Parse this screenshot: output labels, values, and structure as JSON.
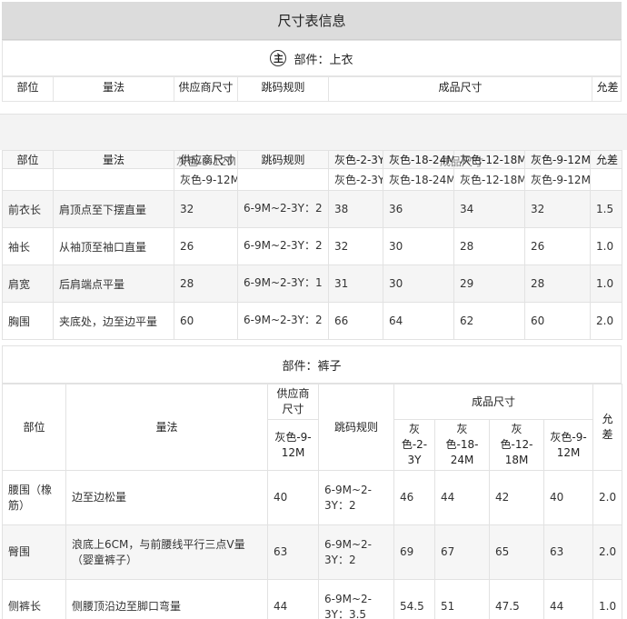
{
  "page_title": "尺寸表信息",
  "top_section": {
    "badge": "主",
    "part_label": "部件：上衣",
    "header": {
      "position": "部位",
      "method": "量法",
      "supplier_size": "供应商尺寸",
      "grading_rule": "跳码规则",
      "finished_size": "成品尺寸",
      "tolerance": "允差"
    }
  },
  "top_table": {
    "header_row1": [
      "部位",
      "量法",
      "供应商尺寸",
      "跳码规则",
      "灰色-2-3Y",
      "灰色-18-24M",
      "灰色-12-18M",
      "灰色-9-12M",
      "允差"
    ],
    "overlap_text": {
      "supplier_under": "灰色-9-12M",
      "finished_under": "成品尺寸"
    },
    "header_row2": [
      "",
      "",
      "灰色-9-12M",
      "",
      "灰色-2-3Y",
      "灰色-18-24M",
      "灰色-12-18M",
      "灰色-9-12M",
      ""
    ],
    "rows": [
      [
        "前衣长",
        "肩顶点至下摆直量",
        "32",
        "6-9M~2-3Y：2",
        "38",
        "36",
        "34",
        "32",
        "1.5"
      ],
      [
        "袖长",
        "从袖顶至袖口直量",
        "26",
        "6-9M~2-3Y：2",
        "32",
        "30",
        "28",
        "26",
        "1.0"
      ],
      [
        "肩宽",
        "后肩端点平量",
        "28",
        "6-9M~2-3Y：1",
        "31",
        "30",
        "29",
        "28",
        "1.0"
      ],
      [
        "胸围",
        "夹底处，边至边平量",
        "60",
        "6-9M~2-3Y：2",
        "66",
        "64",
        "62",
        "60",
        "2.0"
      ]
    ]
  },
  "pants": {
    "part_label": "部件：裤子",
    "header": {
      "position": "部位",
      "method": "量法",
      "supplier_size": "供应商尺寸",
      "supplier_sub": "灰色-9-12M",
      "grading_rule": "跳码规则",
      "finished_size": "成品尺寸",
      "sizes": [
        "灰色-2-3Y",
        "灰色-18-24M",
        "灰色-12-18M",
        "灰色-9-12M"
      ],
      "tolerance": "允差"
    },
    "rows": [
      [
        "腰围（橡筋）",
        "边至边松量",
        "40",
        "6-9M~2-3Y：2",
        "46",
        "44",
        "42",
        "40",
        "2.0"
      ],
      [
        "臀围",
        "浪底上6CM，与前腰线平行三点V量（婴童裤子）",
        "63",
        "6-9M~2-3Y：2",
        "69",
        "67",
        "65",
        "63",
        "2.0"
      ],
      [
        "侧裤长",
        "侧腰顶沿边至脚口弯量",
        "44",
        "6-9M~2-3Y：3.5",
        "54.5",
        "51",
        "47.5",
        "44",
        "1.0"
      ]
    ]
  }
}
